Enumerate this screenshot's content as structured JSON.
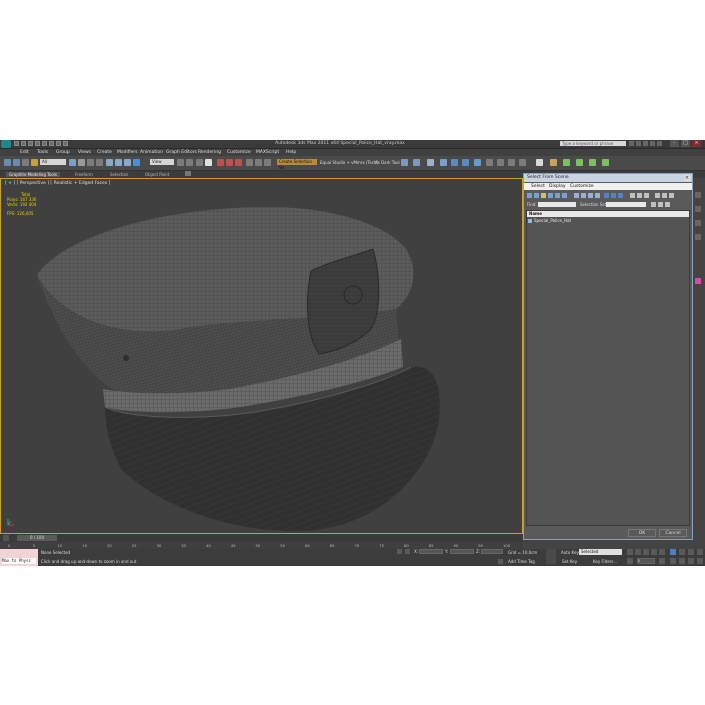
{
  "window": {
    "title": "Autodesk 3ds Max  2011 x64       Special_Police_Hat_vray.max",
    "search_placeholder": "Type a keyword or phrase"
  },
  "menu": [
    "Edit",
    "Tools",
    "Group",
    "Views",
    "Create",
    "Modifiers",
    "Animation",
    "Graph Editors",
    "Rendering",
    "Customize",
    "MAXScript",
    "Help"
  ],
  "toolbar": {
    "selection_filter": "All",
    "ref_coord": "View",
    "named_sel": "Create Selection Se",
    "render_preset": "Equal Studio + vMmrx (Tech)",
    "as_tool_label": "As Dark Tool"
  },
  "ribbon_tabs": [
    "Graphite Modeling Tools",
    "Freeform",
    "Selection",
    "Object Paint"
  ],
  "viewport": {
    "label": "[ + ] [ Perspective ] [ Realistic + Edged Faces ]",
    "stats": {
      "total_label": "Total",
      "polys_label": "Polys:",
      "polys_value": "167 336",
      "verts_label": "Verts:",
      "verts_value": "192 404",
      "fps_label": "FPS:",
      "fps_value": "126,005"
    }
  },
  "dialog": {
    "title": "Select From Scene",
    "menu": [
      "Select",
      "Display",
      "Customize"
    ],
    "find_label": "Find:",
    "selection_set_label": "Selection Set:",
    "column_header": "Name",
    "items": [
      "Special_Police_Hat"
    ],
    "ok_label": "OK",
    "cancel_label": "Cancel"
  },
  "timeline": {
    "frame_slider": "0 / 100",
    "ticks": [
      "0",
      "5",
      "10",
      "15",
      "20",
      "25",
      "30",
      "35",
      "40",
      "45",
      "50",
      "55",
      "60",
      "65",
      "70",
      "75",
      "80",
      "85",
      "90",
      "95",
      "100"
    ]
  },
  "status": {
    "maxscript_text": "Max to Physc",
    "selection_status": "None Selected",
    "prompt": "Click and drag up-and-down to zoom in and out",
    "x_label": "X:",
    "y_label": "Y:",
    "z_label": "Z:",
    "grid": "Grid = 10,0cm",
    "add_time_tag": "Add Time Tag",
    "auto_key": "Auto Key",
    "auto_key_mode": "Selected",
    "set_key": "Set Key",
    "key_filters": "Key Filters...",
    "frame": "0"
  },
  "colors": {
    "viewport_bg": "#404040",
    "viewport_border": "#c9a227",
    "stats_text": "#e8d200",
    "dialog_title_bg": "#c8d4e2",
    "maxscript_bg": "#f2d4d8",
    "app_logo": "#1a8a8a"
  }
}
